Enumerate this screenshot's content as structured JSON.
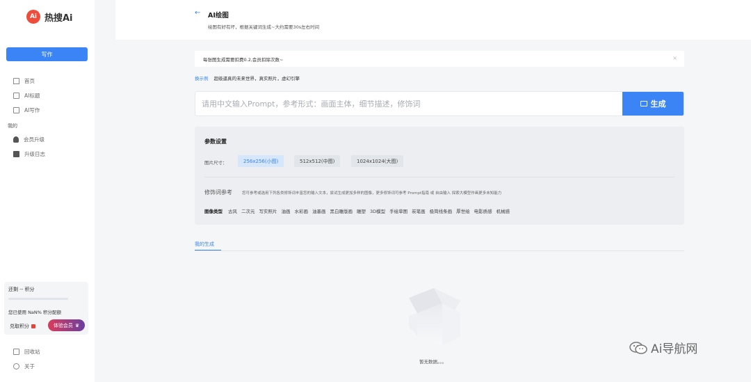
{
  "brand": {
    "logo_mark": "Ai",
    "name": "热搜Ai"
  },
  "sidebar": {
    "write_button": "写作",
    "nav": [
      {
        "label": "首页",
        "icon": "home-icon"
      },
      {
        "label": "AI标题",
        "icon": "doc-icon"
      },
      {
        "label": "AI写作",
        "icon": "edit-icon"
      }
    ],
    "section_label": "我的",
    "nav2": [
      {
        "label": "会员升级",
        "icon": "user-icon"
      },
      {
        "label": "升级日志",
        "icon": "log-icon"
      }
    ],
    "points": {
      "title": "还剩 -- 积分",
      "note": "您已使用 NaN% 积分配额",
      "redeem": "兑取积分",
      "trial_button": "体验会员"
    },
    "nav3": [
      {
        "label": "回收站",
        "icon": "trash-icon"
      },
      {
        "label": "关于",
        "icon": "info-icon"
      }
    ]
  },
  "header": {
    "title": "AI绘图",
    "subtitle": "绘图有好有坏，根据关键词生成~大约需要30s左右时间"
  },
  "notice": {
    "text": "每张图生成需要扣费0.2,会员扣除次数~",
    "close": "×"
  },
  "example": {
    "link": "换示例",
    "text": "超级逼真的未来世界，真实照片，虚幻引擎"
  },
  "prompt": {
    "placeholder": "请用中文输入Prompt，参考形式：画面主体，细节描述，修饰词",
    "value": "",
    "generate_button": "生成"
  },
  "params": {
    "title": "参数设置",
    "size_label": "图片尺寸：",
    "sizes": [
      "256x256(小图)",
      "512x512(中图)",
      "1024x1024(大图)"
    ],
    "selected_size": "256x256(小图)",
    "modifier_title": "修饰词参考",
    "modifier_desc": "您可参考或选用下列各类修饰词丰富您的输入文本，尝试生成更加多样的图像，更多修饰词可参考 Prompt指南 或 自由输入 探索大模型作画更多未知能力",
    "image_type_label": "图像类型",
    "image_types": [
      "古风",
      "二次元",
      "写实照片",
      "油画",
      "水彩画",
      "油墨画",
      "黑白雕版画",
      "雕塑",
      "3D模型",
      "手绘草图",
      "炭笔画",
      "极简线条画",
      "厚世绘",
      "电影质感",
      "机械感"
    ]
  },
  "results": {
    "tab": "我的生成",
    "empty_text": "暂无数据。。。"
  },
  "watermark": {
    "text": "Ai导航网"
  },
  "colors": {
    "accent": "#3a84f5",
    "brand": "#ee4d3b"
  }
}
